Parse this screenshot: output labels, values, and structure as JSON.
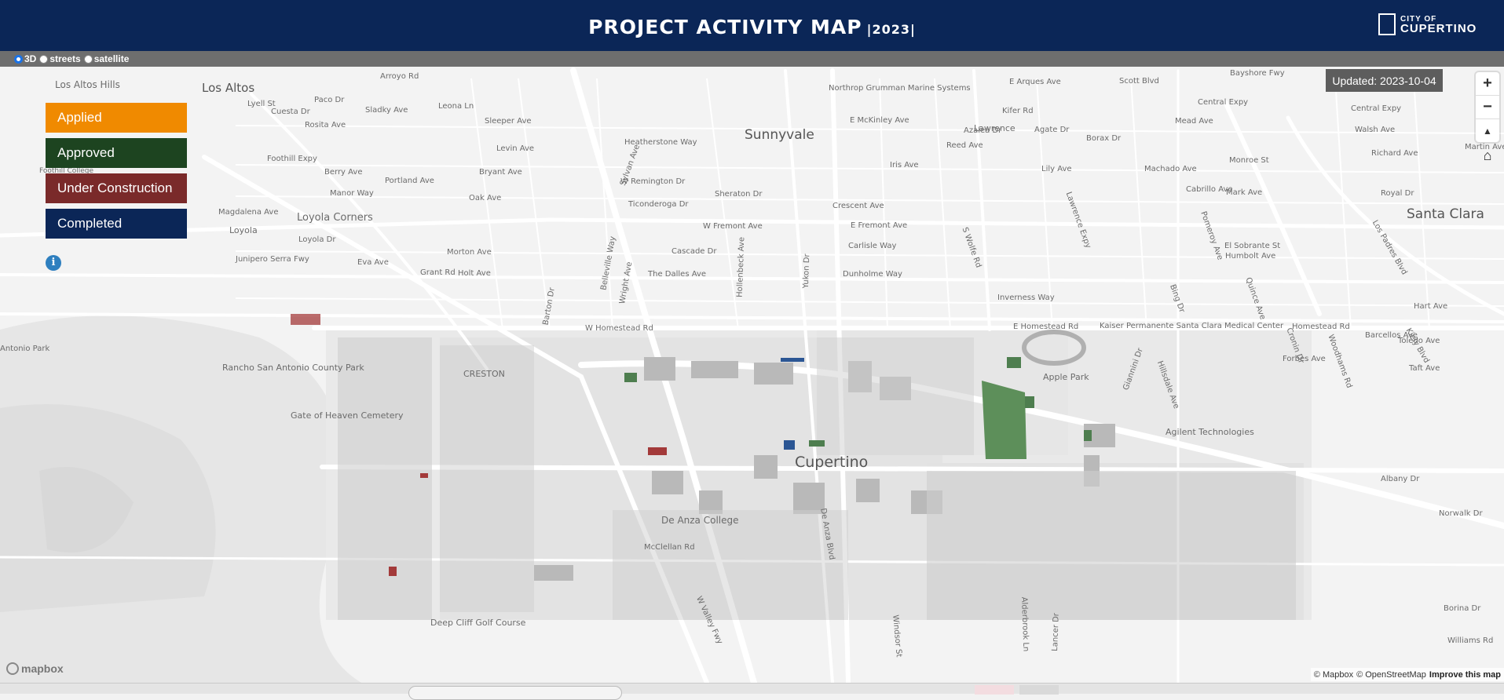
{
  "header": {
    "title": "PROJECT ACTIVITY MAP",
    "year": "|2023|",
    "logo_line1": "CITY OF",
    "logo_line2": "CUPERTINO"
  },
  "layers": [
    {
      "label": "3D",
      "selected": true
    },
    {
      "label": "streets",
      "selected": false
    },
    {
      "label": "satellite",
      "selected": false
    }
  ],
  "legend": [
    {
      "label": "Applied",
      "color": "#f08a00"
    },
    {
      "label": "Approved",
      "color": "#1d4420"
    },
    {
      "label": "Under Construction",
      "color": "#7a2a2a"
    },
    {
      "label": "Completed",
      "color": "#0b2657"
    }
  ],
  "info_icon": "info-icon",
  "updated": "Updated: 2023-10-04",
  "controls": {
    "zoom_in": "+",
    "zoom_out": "−",
    "compass": "▲",
    "home": "⌂"
  },
  "attribution": {
    "mapbox": "© Mapbox",
    "osm": "© OpenStreetMap",
    "improve": "Improve this map"
  },
  "mapbox_logo": "mapbox",
  "map": {
    "cities": {
      "sunnyvale": "Sunnyvale",
      "cupertino": "Cupertino",
      "santa_clara": "Santa Clara",
      "los_altos": "Los Altos"
    },
    "places": {
      "los_altos_hills": "Los Altos Hills",
      "loyola_corners": "Loyola Corners",
      "loyola": "Loyola",
      "foothill_college": "Foothill College",
      "rancho": "Rancho San Antonio County Park",
      "gate_of_heaven": "Gate of Heaven Cemetery",
      "de_anza": "De Anza College",
      "deep_cliff": "Deep Cliff Golf Course",
      "apple_park": "Apple Park",
      "kaiser": "Kaiser Permanente Santa Clara Medical Center",
      "agilent": "Agilent Technologies",
      "northrop": "Northrop Grumman Marine Systems",
      "lawrence": "Lawrence",
      "creston": "CRESTON",
      "antonio": "Antonio Park"
    },
    "streets": {
      "w_homestead": "W Homestead Rd",
      "e_homestead": "E Homestead Rd",
      "homestead": "Homestead Rd",
      "w_fremont": "W Fremont Ave",
      "e_fremont": "E Fremont Ave",
      "inverness": "Inverness Way",
      "the_dalles": "The Dalles Ave",
      "dunholme": "Dunholme Way",
      "cascade": "Cascade Dr",
      "carlisle": "Carlisle Way",
      "crescent": "Crescent Ave",
      "iris": "Iris Ave",
      "w_remington": "W Remington Dr",
      "ticonderoga": "Ticonderoga Dr",
      "sheraton": "Sheraton Dr",
      "heatherstone": "Heatherstone Way",
      "levin": "Levin Ave",
      "bryant": "Bryant Ave",
      "oak": "Oak Ave",
      "morton": "Morton Ave",
      "holt": "Holt Ave",
      "berry": "Berry Ave",
      "manor": "Manor Way",
      "portland": "Portland Ave",
      "magdalena": "Magdalena Ave",
      "foothill": "Foothill Expy",
      "junipero": "Junipero Serra Fwy",
      "eva": "Eva Ave",
      "loyola_dr": "Loyola Dr",
      "grant": "Grant Rd",
      "cuesta": "Cuesta Dr",
      "rosita": "Rosita Ave",
      "lyell": "Lyell St",
      "sladky": "Sladky Ave",
      "paco": "Paco Dr",
      "leona": "Leona Ln",
      "sleeper": "Sleeper Ave",
      "arroyo": "Arroyo Rd",
      "e_arques": "E Arques Ave",
      "scott": "Scott Blvd",
      "bayshore": "Bayshore Fwy",
      "kifer": "Kifer Rd",
      "e_mckinley": "E McKinley Ave",
      "azalea": "Azalea Dr",
      "reed": "Reed Ave",
      "agate": "Agate Dr",
      "borax": "Borax Dr",
      "central_expy": "Central Expy",
      "mead": "Mead Ave",
      "walsh": "Walsh Ave",
      "richard": "Richard Ave",
      "martin": "Martin Ave",
      "monroe": "Monroe St",
      "machado": "Machado Ave",
      "cabrillo": "Cabrillo Ave",
      "mark": "Mark Ave",
      "royal": "Royal Dr",
      "el_sobrante": "El Sobrante St",
      "humbolt": "Humbolt Ave",
      "lily": "Lily Ave",
      "forbes": "Forbes Ave",
      "barcellos": "Barcellos Ave",
      "toledo": "Toledo Ave",
      "taft": "Taft Ave",
      "hart": "Hart Ave",
      "albany": "Albany Dr",
      "norwalk": "Norwalk Dr",
      "borina": "Borina Dr",
      "williams": "Williams Rd",
      "mcclellan": "McClellan Rd",
      "w_valley": "W Valley Fwy",
      "windsor": "Windsor St",
      "lancer": "Lancer Dr",
      "alderbrook": "Alderbrook Ln",
      "de_anza_blvd": "De Anza Blvd",
      "wright": "Wright Ave",
      "belleville": "Belleville Way",
      "barton": "Barton Dr",
      "hollenbeck": "Hollenbeck Ave",
      "yukon": "Yukon Dr",
      "sylvan": "Sylvan Ave",
      "lawrence_expy": "Lawrence Expy",
      "s_wolfe": "S Wolfe Rd",
      "quince": "Quince Ave",
      "bing": "Bing Dr",
      "pomeroy": "Pomeroy Ave",
      "los_padres": "Los Padres Blvd",
      "woodhams": "Woodhams Rd",
      "kiely": "Kiely Blvd",
      "cronin": "Cronin Dr",
      "hillsdale": "Hillsdale Ave",
      "giannini": "Giannini Dr"
    }
  }
}
